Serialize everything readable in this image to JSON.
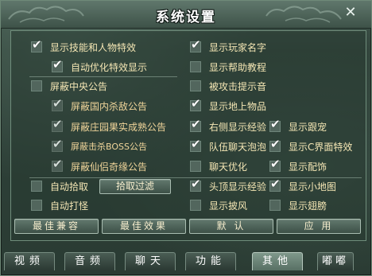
{
  "window": {
    "title": "系统设置",
    "close_glyph": "✕"
  },
  "left_group": {
    "show_skill_effects": {
      "label": "显示技能和人物特效",
      "checked": true
    },
    "auto_optimize_effects": {
      "label": "自动优化特效显示",
      "checked": true
    }
  },
  "announcements": {
    "block_center_announcement": {
      "label": "屏蔽中央公告",
      "checked": false
    },
    "items": [
      {
        "label": "屏蔽国内杀敌公告",
        "checked": true
      },
      {
        "label": "屏蔽庄园果实成熟公告",
        "checked": true
      },
      {
        "label": "屏蔽击杀BOSS公告",
        "checked": true
      },
      {
        "label": "屏蔽仙侣奇缘公告",
        "checked": true
      }
    ]
  },
  "pickup": {
    "auto_pickup": {
      "label": "自动拾取",
      "checked": false
    },
    "filter_button": "拾取过滤",
    "auto_fight": {
      "label": "自动打怪",
      "checked": false
    }
  },
  "middle_column": [
    {
      "label": "显示玩家名字",
      "checked": true
    },
    {
      "label": "显示帮助教程",
      "checked": false
    },
    {
      "label": "被攻击提示音",
      "checked": false
    },
    {
      "label": "显示地上物品",
      "checked": true
    },
    {
      "label": "右侧显示经验",
      "checked": true
    },
    {
      "label": "队伍聊天泡泡",
      "checked": true
    },
    {
      "label": "聊天优化",
      "checked": false
    },
    {
      "label": "头顶显示经验",
      "checked": true
    },
    {
      "label": "显示披风",
      "checked": false
    }
  ],
  "right_column": [
    {
      "label": "显示跟宠",
      "checked": true
    },
    {
      "label": "显示C界面特效",
      "checked": true
    },
    {
      "label": "显示配饰",
      "checked": true
    },
    {
      "label": "显示小地图",
      "checked": true
    },
    {
      "label": "显示翅膀",
      "checked": false
    }
  ],
  "action_buttons": {
    "best_compat": "最佳兼容",
    "best_effect": "最佳效果",
    "default": "默 认",
    "apply": "应 用"
  },
  "tabs": [
    {
      "label": "视频",
      "active": false
    },
    {
      "label": "音频",
      "active": false
    },
    {
      "label": "聊天",
      "active": false
    },
    {
      "label": "功能",
      "active": false
    },
    {
      "label": "其他",
      "active": true
    },
    {
      "label": "嘟嘟",
      "active": false
    }
  ],
  "checkmark_glyph": "✔",
  "colors": {
    "label_text": "#f4e6b4",
    "active_tab": "#7f988b",
    "panel_border": "#6f8d7b"
  }
}
